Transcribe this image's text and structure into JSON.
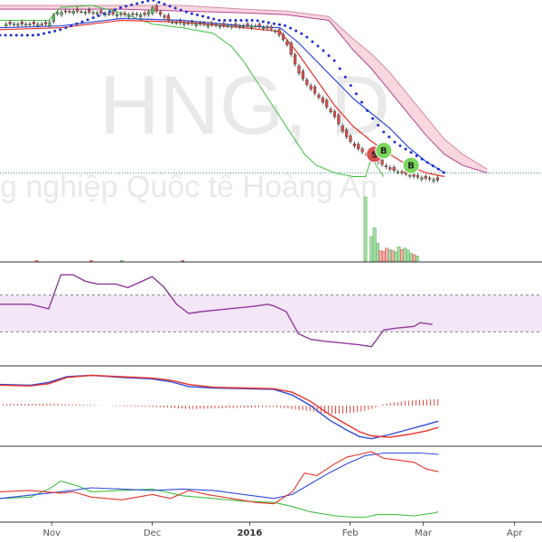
{
  "watermark": {
    "ticker": "HNG, D",
    "company": "g nghiệp Quốc tế Hoàng An"
  },
  "colors": {
    "up": "#5cb85c",
    "down": "#d9534f",
    "cloud": "#f5c6d2",
    "cloud_edge": "#d98aa8",
    "rsi": "#8e3a9b",
    "rsi_band": "#f3e6f7",
    "blue": "#2f4bdc",
    "red": "#e8322b",
    "green": "#3fbf3f",
    "pink_line": "#b5458f",
    "sar": "#1f2fd1",
    "price_line": "#3e8e7e"
  },
  "chart_data": [
    {
      "type": "candlestick",
      "panel": "price",
      "title": "HNG, D",
      "x_labels": [
        "Nov",
        "Dec",
        "2016",
        "Feb",
        "Mar",
        "Apr"
      ],
      "x_label_days": [
        7,
        40,
        72,
        105,
        129,
        159
      ],
      "x_range": [
        -10,
        168
      ],
      "ylim": [
        0,
        100
      ],
      "last_price": 10,
      "price_path": [
        [
          -10,
          90
        ],
        [
          6,
          90
        ],
        [
          8,
          96
        ],
        [
          14,
          97
        ],
        [
          22,
          96
        ],
        [
          30,
          95
        ],
        [
          38,
          95
        ],
        [
          40,
          99
        ],
        [
          42,
          96
        ],
        [
          46,
          91
        ],
        [
          55,
          90
        ],
        [
          66,
          89
        ],
        [
          74,
          89
        ],
        [
          80,
          87
        ],
        [
          84,
          80
        ],
        [
          86,
          72
        ],
        [
          88,
          64
        ],
        [
          91,
          57
        ],
        [
          95,
          50
        ],
        [
          100,
          40
        ],
        [
          103,
          31
        ],
        [
          106,
          25
        ],
        [
          110,
          20
        ],
        [
          114,
          16
        ],
        [
          118,
          12
        ],
        [
          122,
          10
        ],
        [
          126,
          8
        ],
        [
          130,
          7
        ],
        [
          134,
          6
        ]
      ],
      "sar_path": [
        [
          -10,
          84
        ],
        [
          2,
          84
        ],
        [
          10,
          87
        ],
        [
          20,
          93
        ],
        [
          30,
          99
        ],
        [
          40,
          103
        ],
        [
          52,
          96
        ],
        [
          62,
          92
        ],
        [
          74,
          92
        ],
        [
          84,
          89
        ],
        [
          90,
          84
        ],
        [
          96,
          76
        ],
        [
          100,
          70
        ],
        [
          104,
          60
        ],
        [
          108,
          50
        ],
        [
          112,
          40
        ],
        [
          116,
          32
        ],
        [
          120,
          26
        ],
        [
          126,
          20
        ],
        [
          132,
          14
        ],
        [
          136,
          10
        ]
      ],
      "ma_blue": [
        [
          -10,
          88
        ],
        [
          10,
          89
        ],
        [
          30,
          93
        ],
        [
          50,
          92
        ],
        [
          70,
          89
        ],
        [
          82,
          88
        ],
        [
          88,
          80
        ],
        [
          94,
          70
        ],
        [
          100,
          60
        ],
        [
          106,
          50
        ],
        [
          112,
          42
        ],
        [
          118,
          34
        ],
        [
          124,
          24
        ],
        [
          130,
          16
        ],
        [
          136,
          10
        ]
      ],
      "ma_red": [
        [
          -10,
          87
        ],
        [
          10,
          88
        ],
        [
          30,
          92
        ],
        [
          50,
          91
        ],
        [
          70,
          88
        ],
        [
          82,
          86
        ],
        [
          88,
          74
        ],
        [
          94,
          60
        ],
        [
          100,
          46
        ],
        [
          106,
          35
        ],
        [
          112,
          27
        ],
        [
          118,
          20
        ],
        [
          124,
          14
        ],
        [
          130,
          10
        ],
        [
          136,
          8
        ]
      ],
      "chikou_green": [
        [
          -10,
          92
        ],
        [
          6,
          92
        ],
        [
          10,
          99
        ],
        [
          20,
          100
        ],
        [
          30,
          96
        ],
        [
          40,
          90
        ],
        [
          50,
          88
        ],
        [
          60,
          85
        ],
        [
          66,
          78
        ],
        [
          70,
          70
        ],
        [
          74,
          60
        ],
        [
          78,
          50
        ],
        [
          82,
          40
        ],
        [
          86,
          30
        ],
        [
          90,
          20
        ],
        [
          94,
          14
        ],
        [
          100,
          10
        ],
        [
          106,
          8
        ],
        [
          110,
          8
        ],
        [
          112,
          18
        ],
        [
          116,
          8
        ]
      ],
      "cloud_top": [
        [
          -10,
          100
        ],
        [
          10,
          100
        ],
        [
          30,
          100
        ],
        [
          50,
          100
        ],
        [
          70,
          98
        ],
        [
          84,
          97
        ],
        [
          98,
          94
        ],
        [
          102,
          88
        ],
        [
          106,
          82
        ],
        [
          112,
          74
        ],
        [
          118,
          64
        ],
        [
          124,
          52
        ],
        [
          130,
          40
        ],
        [
          136,
          28
        ],
        [
          142,
          20
        ],
        [
          150,
          12
        ]
      ],
      "cloud_bottom": [
        [
          -10,
          98
        ],
        [
          10,
          98
        ],
        [
          30,
          98
        ],
        [
          50,
          97
        ],
        [
          70,
          96
        ],
        [
          84,
          95
        ],
        [
          98,
          92
        ],
        [
          102,
          84
        ],
        [
          106,
          76
        ],
        [
          112,
          66
        ],
        [
          118,
          54
        ],
        [
          124,
          42
        ],
        [
          130,
          30
        ],
        [
          136,
          20
        ],
        [
          142,
          14
        ],
        [
          150,
          10
        ]
      ],
      "markers": [
        {
          "type": "sell",
          "label": "S",
          "day": 113,
          "y": 20
        },
        {
          "type": "buy",
          "label": "B",
          "day": 116,
          "y": 22
        },
        {
          "type": "buy",
          "label": "B",
          "day": 125,
          "y": 14
        }
      ]
    },
    {
      "type": "bar",
      "panel": "volume",
      "ylim": [
        0,
        100
      ],
      "values": [
        [
          2,
          1,
          "down"
        ],
        [
          20,
          1,
          "down"
        ],
        [
          30,
          1,
          "up"
        ],
        [
          50,
          1,
          "down"
        ],
        [
          110,
          100,
          "up"
        ],
        [
          112,
          38,
          "up"
        ],
        [
          113,
          52,
          "up"
        ],
        [
          114,
          28,
          "up"
        ],
        [
          115,
          16,
          "down"
        ],
        [
          116,
          15,
          "down"
        ],
        [
          117,
          20,
          "down"
        ],
        [
          118,
          18,
          "up"
        ],
        [
          119,
          16,
          "down"
        ],
        [
          120,
          14,
          "up"
        ],
        [
          121,
          22,
          "up"
        ],
        [
          122,
          18,
          "down"
        ],
        [
          123,
          20,
          "up"
        ],
        [
          124,
          17,
          "up"
        ],
        [
          125,
          12,
          "up"
        ],
        [
          126,
          10,
          "down"
        ],
        [
          127,
          8,
          "up"
        ]
      ]
    },
    {
      "type": "line",
      "panel": "rsi",
      "ylim": [
        0,
        100
      ],
      "band": [
        30,
        70
      ],
      "values": [
        [
          -10,
          60
        ],
        [
          0,
          60
        ],
        [
          6,
          55
        ],
        [
          10,
          92
        ],
        [
          14,
          92
        ],
        [
          18,
          85
        ],
        [
          22,
          82
        ],
        [
          28,
          82
        ],
        [
          32,
          78
        ],
        [
          36,
          84
        ],
        [
          40,
          90
        ],
        [
          44,
          78
        ],
        [
          48,
          60
        ],
        [
          52,
          50
        ],
        [
          56,
          52
        ],
        [
          62,
          54
        ],
        [
          68,
          56
        ],
        [
          74,
          58
        ],
        [
          78,
          60
        ],
        [
          80,
          58
        ],
        [
          84,
          52
        ],
        [
          88,
          28
        ],
        [
          92,
          22
        ],
        [
          96,
          20
        ],
        [
          102,
          18
        ],
        [
          108,
          16
        ],
        [
          112,
          14
        ],
        [
          116,
          32
        ],
        [
          120,
          34
        ],
        [
          126,
          36
        ],
        [
          128,
          40
        ],
        [
          132,
          38
        ]
      ]
    },
    {
      "type": "line",
      "panel": "macd",
      "ylim": [
        -100,
        100
      ],
      "macd": [
        [
          -10,
          60
        ],
        [
          0,
          58
        ],
        [
          6,
          66
        ],
        [
          12,
          82
        ],
        [
          20,
          86
        ],
        [
          30,
          80
        ],
        [
          40,
          76
        ],
        [
          46,
          68
        ],
        [
          52,
          54
        ],
        [
          60,
          50
        ],
        [
          70,
          48
        ],
        [
          80,
          46
        ],
        [
          86,
          30
        ],
        [
          92,
          0
        ],
        [
          98,
          -40
        ],
        [
          104,
          -70
        ],
        [
          108,
          -88
        ],
        [
          112,
          -94
        ],
        [
          118,
          -82
        ],
        [
          124,
          -68
        ],
        [
          130,
          -54
        ],
        [
          134,
          -44
        ]
      ],
      "signal": [
        [
          -10,
          58
        ],
        [
          0,
          56
        ],
        [
          6,
          62
        ],
        [
          12,
          80
        ],
        [
          20,
          86
        ],
        [
          30,
          82
        ],
        [
          40,
          78
        ],
        [
          46,
          72
        ],
        [
          52,
          60
        ],
        [
          60,
          52
        ],
        [
          70,
          50
        ],
        [
          80,
          48
        ],
        [
          86,
          38
        ],
        [
          92,
          12
        ],
        [
          98,
          -24
        ],
        [
          104,
          -54
        ],
        [
          108,
          -74
        ],
        [
          112,
          -86
        ],
        [
          118,
          -90
        ],
        [
          124,
          -82
        ],
        [
          130,
          -72
        ],
        [
          134,
          -62
        ]
      ],
      "histogram": [
        [
          -10,
          4
        ],
        [
          0,
          5
        ],
        [
          6,
          6
        ],
        [
          12,
          4
        ],
        [
          20,
          2
        ],
        [
          30,
          -2
        ],
        [
          40,
          -4
        ],
        [
          46,
          -6
        ],
        [
          52,
          -10
        ],
        [
          60,
          -8
        ],
        [
          70,
          -6
        ],
        [
          80,
          -4
        ],
        [
          86,
          -10
        ],
        [
          92,
          -16
        ],
        [
          98,
          -24
        ],
        [
          104,
          -22
        ],
        [
          108,
          -18
        ],
        [
          112,
          -10
        ],
        [
          116,
          4
        ],
        [
          120,
          10
        ],
        [
          124,
          14
        ],
        [
          128,
          16
        ],
        [
          132,
          18
        ],
        [
          134,
          18
        ]
      ]
    },
    {
      "type": "line",
      "panel": "dmi",
      "ylim": [
        0,
        100
      ],
      "adx_blue": [
        [
          -10,
          30
        ],
        [
          0,
          35
        ],
        [
          10,
          40
        ],
        [
          20,
          46
        ],
        [
          30,
          44
        ],
        [
          40,
          42
        ],
        [
          50,
          44
        ],
        [
          60,
          42
        ],
        [
          70,
          36
        ],
        [
          80,
          30
        ],
        [
          86,
          36
        ],
        [
          92,
          52
        ],
        [
          98,
          68
        ],
        [
          104,
          82
        ],
        [
          110,
          94
        ],
        [
          116,
          98
        ],
        [
          122,
          98
        ],
        [
          128,
          98
        ],
        [
          134,
          96
        ]
      ],
      "di_plus_red": [
        [
          -10,
          40
        ],
        [
          0,
          42
        ],
        [
          10,
          38
        ],
        [
          14,
          40
        ],
        [
          20,
          32
        ],
        [
          30,
          28
        ],
        [
          40,
          36
        ],
        [
          46,
          30
        ],
        [
          52,
          42
        ],
        [
          58,
          36
        ],
        [
          66,
          30
        ],
        [
          74,
          24
        ],
        [
          80,
          22
        ],
        [
          86,
          40
        ],
        [
          90,
          68
        ],
        [
          94,
          64
        ],
        [
          100,
          82
        ],
        [
          104,
          92
        ],
        [
          108,
          96
        ],
        [
          112,
          100
        ],
        [
          116,
          90
        ],
        [
          120,
          88
        ],
        [
          126,
          84
        ],
        [
          130,
          74
        ],
        [
          134,
          70
        ]
      ],
      "di_minus_green": [
        [
          -10,
          30
        ],
        [
          0,
          32
        ],
        [
          6,
          44
        ],
        [
          10,
          56
        ],
        [
          16,
          48
        ],
        [
          20,
          40
        ],
        [
          30,
          42
        ],
        [
          40,
          44
        ],
        [
          50,
          34
        ],
        [
          60,
          30
        ],
        [
          70,
          26
        ],
        [
          80,
          24
        ],
        [
          86,
          18
        ],
        [
          92,
          10
        ],
        [
          100,
          4
        ],
        [
          106,
          2
        ],
        [
          110,
          2
        ],
        [
          114,
          6
        ],
        [
          120,
          6
        ],
        [
          126,
          4
        ],
        [
          132,
          8
        ],
        [
          134,
          10
        ]
      ]
    }
  ]
}
